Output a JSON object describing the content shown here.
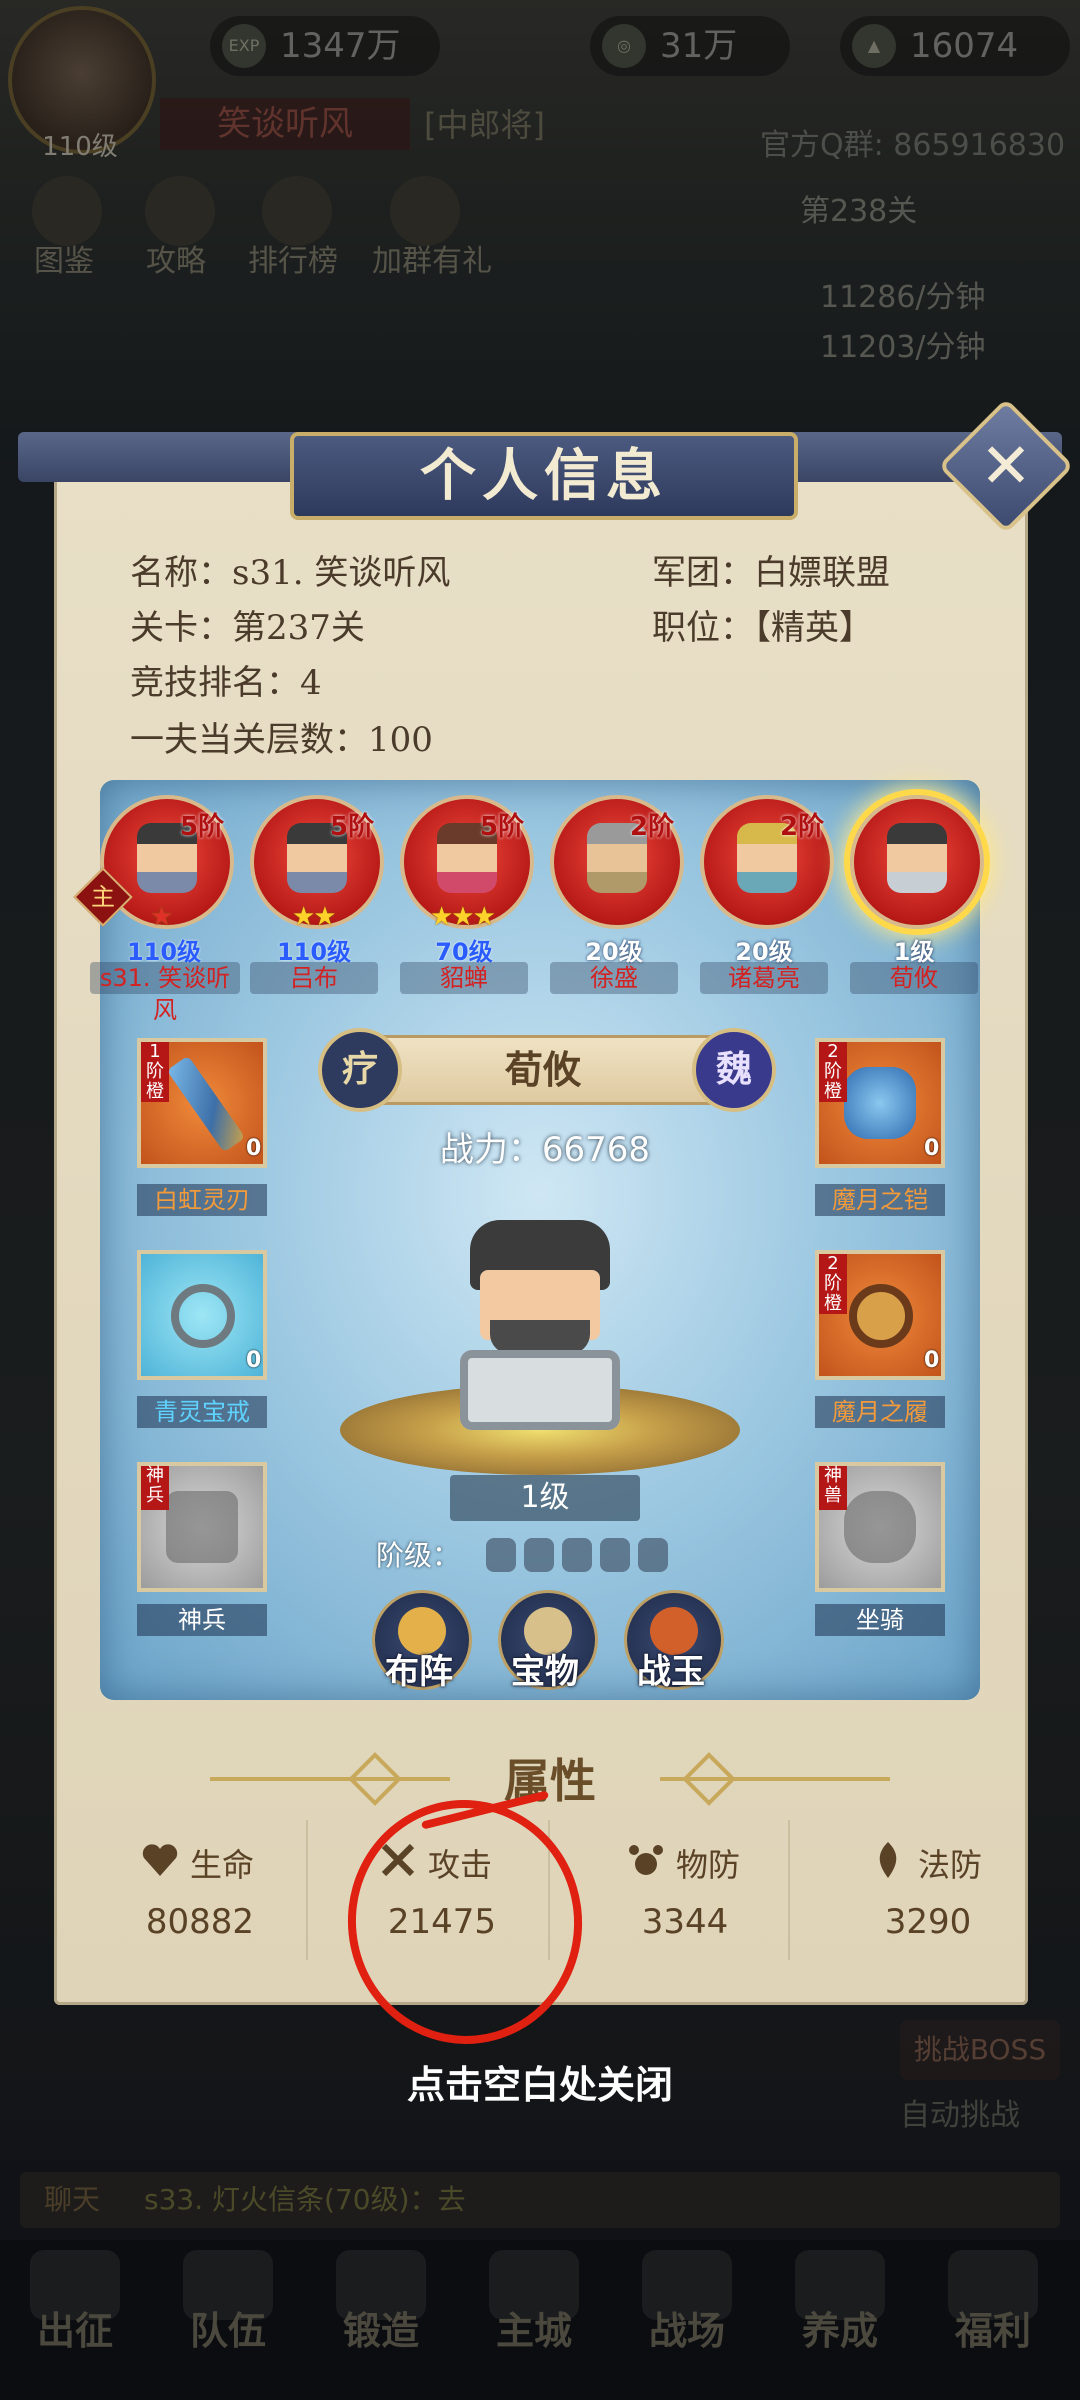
{
  "top": {
    "level": "110级",
    "exp": "1347万",
    "coins": "31万",
    "gold": "16074",
    "player_name": "笑谈听风",
    "player_rank": "[中郎将]",
    "qq_group": "官方Q群: 865916830",
    "stage": "第238关",
    "coin_rate": "11286/分钟",
    "exp_rate": "11203/分钟",
    "menu": [
      "图鉴",
      "攻略",
      "排行榜",
      "加群有礼"
    ]
  },
  "modal": {
    "title": "个人信息",
    "close_icon": "close-icon",
    "info": {
      "name": "名称：s31. 笑谈听风",
      "stage": "关卡：第237关",
      "arena_rank": "竞技排名：4",
      "tower": "一夫当关层数：100",
      "legion": "军团：白嫖联盟",
      "position": "职位：【精英】"
    },
    "heroes": [
      {
        "rank": "5阶",
        "stars": "★",
        "level": "110级",
        "name": "s31. 笑谈听风"
      },
      {
        "rank": "5阶",
        "stars": "★★",
        "level": "110级",
        "name": "吕布"
      },
      {
        "rank": "5阶",
        "stars": "★★★",
        "level": "70级",
        "name": "貂蝉"
      },
      {
        "rank": "2阶",
        "stars": "",
        "level": "20级",
        "name": "徐盛"
      },
      {
        "rank": "2阶",
        "stars": "",
        "level": "20级",
        "name": "诸葛亮"
      },
      {
        "rank": "",
        "stars": "",
        "level": "1级",
        "name": "荀攸"
      }
    ],
    "lord_badge": "主",
    "selected": {
      "name": "荀攸",
      "left_tag": "疗",
      "right_tag": "魏",
      "power": "战力：66768",
      "level": "1级",
      "rank_label": "阶级：",
      "rank_fill": 0
    },
    "equipment_left": [
      {
        "rank": "1阶橙",
        "count": "0",
        "label": "白虹灵刃"
      },
      {
        "rank": "",
        "count": "0",
        "label": "青灵宝戒"
      },
      {
        "rank": "神兵",
        "count": "",
        "label": "神兵"
      }
    ],
    "equipment_right": [
      {
        "rank": "2阶橙",
        "count": "0",
        "label": "魔月之铠"
      },
      {
        "rank": "2阶橙",
        "count": "0",
        "label": "魔月之履"
      },
      {
        "rank": "神兽",
        "count": "",
        "label": "坐骑"
      }
    ],
    "actions": [
      "布阵",
      "宝物",
      "战玉"
    ],
    "attributes_title": "属性",
    "attributes": [
      {
        "name": "生命",
        "value": "80882",
        "icon": "heart-icon"
      },
      {
        "name": "攻击",
        "value": "21475",
        "icon": "crossed-swords-icon"
      },
      {
        "name": "物防",
        "value": "3344",
        "icon": "paw-shield-icon"
      },
      {
        "name": "法防",
        "value": "3290",
        "icon": "flame-shield-icon"
      }
    ],
    "close_hint": "点击空白处关闭"
  },
  "behind": {
    "chat_tag": "聊天",
    "chat_msg": "s33. 灯火信条(70级)：去",
    "challenge": "挑战BOSS",
    "auto": "自动挑战",
    "bottom_nav": [
      "出征",
      "队伍",
      "锻造",
      "主城",
      "战场",
      "养成",
      "福利"
    ]
  },
  "colors": {
    "accent_red": "#e02010",
    "panel_beige": "#e6dcc3",
    "title_navy": "#3a4566"
  }
}
